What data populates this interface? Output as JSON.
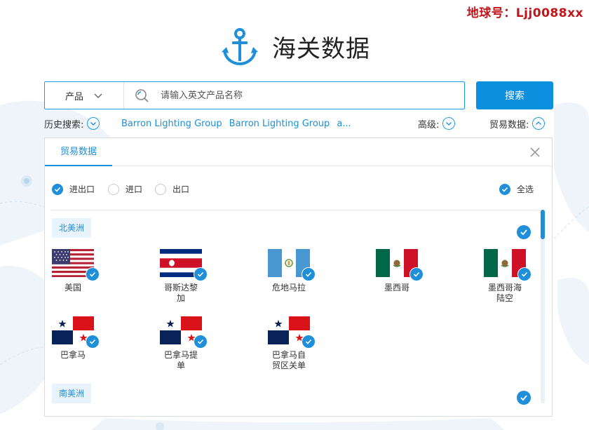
{
  "watermark": "地球号：Ljj0088xx",
  "header": {
    "title": "海关数据"
  },
  "search": {
    "product_label": "产品",
    "placeholder": "请输入英文产品名称",
    "button_label": "搜索"
  },
  "filters": {
    "history_label": "历史搜索:",
    "history_items": [
      "Barron Lighting Group",
      "Barron Lighting Group",
      "a..."
    ],
    "advanced_label": "高级:",
    "trade_label": "贸易数据:"
  },
  "panel": {
    "tab_label": "贸易数据",
    "radios": [
      {
        "label": "进出口",
        "checked": true
      },
      {
        "label": "进口",
        "checked": false
      },
      {
        "label": "出口",
        "checked": false
      }
    ],
    "select_all_label": "全选",
    "regions": [
      {
        "name": "北美洲",
        "countries": [
          {
            "name": "美国",
            "flag": "us-flag"
          },
          {
            "name": "哥斯达黎加",
            "flag": "costa-rica-flag"
          },
          {
            "name": "危地马拉",
            "flag": "guatemala-flag"
          },
          {
            "name": "墨西哥",
            "flag": "mexico-flag"
          },
          {
            "name": "墨西哥海陆空",
            "flag": "mexico-flag"
          },
          {
            "name": "巴拿马",
            "flag": "panama-flag"
          },
          {
            "name": "巴拿马提单",
            "flag": "panama-flag"
          },
          {
            "name": "巴拿马自贸区关单",
            "flag": "panama-flag"
          }
        ]
      },
      {
        "name": "南美洲",
        "countries": []
      }
    ]
  },
  "colors": {
    "accent": "#1e8fd8",
    "button": "#0b8fde",
    "watermark": "#c0161b"
  }
}
